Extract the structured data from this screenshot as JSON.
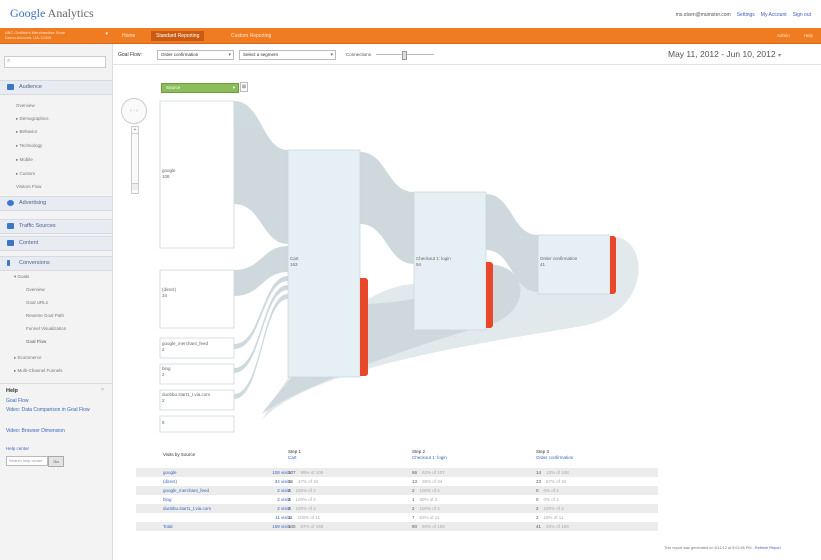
{
  "header": {
    "logo_primary": "Google",
    "logo_secondary": "Analytics",
    "email": "ms.olsen@mumster.com",
    "links": [
      "Settings",
      "My Account",
      "Sign out"
    ]
  },
  "account": {
    "line1": "ABC Outfitters Merchandise Store",
    "line2": "Demo Account, UA-12345"
  },
  "nav_tabs": [
    "Home",
    "Standard Reporting",
    "Custom Reporting"
  ],
  "nav_right": [
    "Admin",
    "Help"
  ],
  "sidebar": {
    "search_placeholder": "",
    "audience_label": "Audience",
    "audience_items": [
      "Overview",
      "Demographics",
      "Behavior",
      "Technology",
      "Mobile",
      "Custom",
      "Visitors Flow"
    ],
    "advertising_label": "Advertising",
    "traffic_label": "Traffic Sources",
    "content_label": "Content",
    "conversions_label": "Conversions",
    "goals_label": "Goals",
    "goal_items": [
      "Overview",
      "Goal URLs",
      "Reverse Goal Path",
      "Funnel Visualization",
      "Goal Flow"
    ],
    "ecommerce_label": "Ecommerce",
    "multichannel_label": "Multi-Channel Funnels",
    "help_title": "Help",
    "help_links": [
      "Goal Flow",
      "Video: Data Comparison in Goal Flow",
      "Video: Browser Dimension"
    ],
    "help_center": "Help center",
    "help_input_placeholder": "Search help center",
    "help_go": "Go"
  },
  "controls": {
    "goal_flow_label": "Goal Flow:",
    "goal_select": "Order confirmation",
    "segment_select": "Select a segment",
    "connections_label": "Connections",
    "date_range": "May 11, 2012 - Jun 10, 2012"
  },
  "flow": {
    "source_select": "Source",
    "zoom_plus": "+",
    "zoom_minus": "−",
    "sources": [
      {
        "name": "google",
        "visits": "108"
      },
      {
        "name": "(direct)",
        "visits": "34"
      },
      {
        "name": "google_merchant_feed",
        "visits": "2"
      },
      {
        "name": "bing",
        "visits": "2"
      },
      {
        "name": "dunbbu.start1_t.via.com",
        "visits": "2"
      },
      {
        "name": "",
        "visits": "8"
      }
    ],
    "steps": [
      {
        "name": "Cart",
        "visits": "163"
      },
      {
        "name": "Checkout 1: login",
        "visits": "94"
      },
      {
        "name": "Order confirmation",
        "visits": "41"
      }
    ]
  },
  "table": {
    "col_source": "Visits by Source",
    "col_step1_title": "Step 1",
    "col_step1_name": "Cart",
    "col_step2_title": "Step 2",
    "col_step2_name": "Checkout 1: login",
    "col_step3_title": "Step 3",
    "col_step3_name": "Order confirmation",
    "rows": [
      {
        "source": "google",
        "visits": "108 visits",
        "s1": "107",
        "s1p": "99% of 108",
        "s2": "66",
        "s2p": "62% of 107",
        "s3": "14",
        "s3p": "13% of 108"
      },
      {
        "source": "(direct)",
        "visits": "34 visits",
        "s1": "16",
        "s1p": "47% of 34",
        "s2": "13",
        "s2p": "38% of 34",
        "s3": "23",
        "s3p": "67% of 34"
      },
      {
        "source": "google_merchant_feed",
        "visits": "2 visits",
        "s1": "2",
        "s1p": "100% of 2",
        "s2": "2",
        "s2p": "100% of 2",
        "s3": "0",
        "s3p": "0% of 2"
      },
      {
        "source": "bing",
        "visits": "2 visits",
        "s1": "2",
        "s1p": "100% of 2",
        "s2": "1",
        "s2p": "50% of 2",
        "s3": "0",
        "s3p": "0% of 2"
      },
      {
        "source": "dunbbu.start1_t.via.com",
        "visits": "2 visits",
        "s1": "2",
        "s1p": "100% of 2",
        "s2": "2",
        "s2p": "100% of 2",
        "s3": "2",
        "s3p": "100% of 2"
      },
      {
        "source": "",
        "visits": "11 visits",
        "s1": "11",
        "s1p": "100% of 11",
        "s2": "7",
        "s2p": "63% of 11",
        "s3": "2",
        "s3p": "18% of 11"
      },
      {
        "source": "Total",
        "visits": "159 visits",
        "s1": "140",
        "s1p": "87% of 159",
        "s2": "90",
        "s2p": "56% of 159",
        "s3": "41",
        "s3p": "25% of 159"
      }
    ]
  },
  "footer": {
    "text": "This report was generated on 6/11/12 at 5:02:46 PM -",
    "link": "Refresh Report"
  },
  "colors": {
    "orange": "#f07c22",
    "exit_red": "#e8472a",
    "flow_gray": "#cfd8dc",
    "source_green": "#8bbd5b",
    "link_blue": "#3a66bd"
  }
}
